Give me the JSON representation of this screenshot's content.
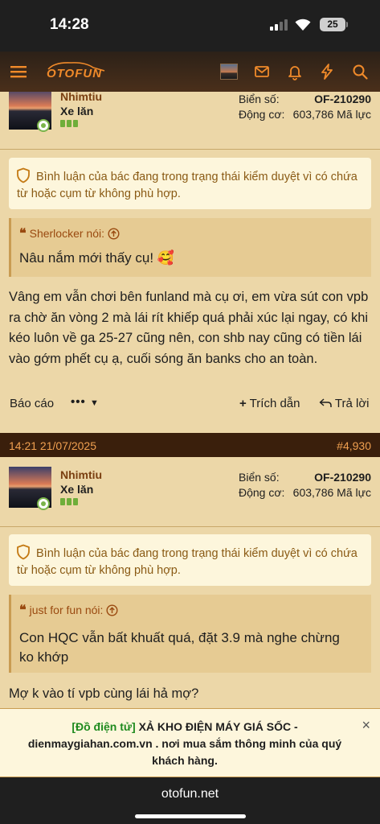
{
  "status_bar": {
    "time": "14:28",
    "battery": "25"
  },
  "nav": {
    "logo": "OTOFUN",
    "icons": [
      "menu-icon",
      "envelope-icon",
      "bell-icon",
      "lightning-icon",
      "search-icon"
    ]
  },
  "posts": [
    {
      "username": "Nhimtiu",
      "user_title": "Xe lăn",
      "plate_label": "Biển số:",
      "plate_value": "OF-210290",
      "engine_label": "Động cơ:",
      "engine_value": "603,786 Mã lực",
      "notice": "Bình luận của bác đang trong trạng thái kiểm duyệt vì có chứa từ hoặc cụm từ không phù hợp.",
      "quote_author": "Sherlocker nói:",
      "quote_text": "Nâu nắm mới thấy cụ! 🥰",
      "body": "Vâng em vẫn chơi bên funland mà cụ ơi, em vừa sút con vpb ra chờ ăn vòng 2 mà lái rít khiếp quá phải xúc lại ngay, có khi kéo luôn về ga 25-27 cũng nên, con shb nay cũng có tiền lái vào gớm phết cụ ạ, cuối sóng ăn banks cho an toàn.",
      "actions": {
        "report": "Báo cáo",
        "more": "•••",
        "quote": "Trích dẫn",
        "reply": "Trả lời"
      }
    },
    {
      "date": "14:21 21/07/2025",
      "number": "#4,930",
      "username": "Nhimtiu",
      "user_title": "Xe lăn",
      "plate_label": "Biển số:",
      "plate_value": "OF-210290",
      "engine_label": "Động cơ:",
      "engine_value": "603,786 Mã lực",
      "notice": "Bình luận của bác đang trong trạng thái kiểm duyệt vì có chứa từ hoặc cụm từ không phù hợp.",
      "quote_author": "just for fun nói:",
      "quote_text": "Con HQC vẫn bất khuất quá, đặt 3.9 mà nghe chừng ko khớp",
      "body": "Mợ k vào tí vpb cùng lái hả mợ?"
    }
  ],
  "ad": {
    "tag": "[Đồ điện tử]",
    "text": "XẢ KHO ĐIỆN MÁY GIÁ SỐC - dienmaygiahan.com.vn . nơi mua sắm thông minh của quý khách hàng.",
    "close": "×"
  },
  "browser": {
    "url": "otofun.net"
  },
  "colors": {
    "page_bg": "#ecd7a8",
    "accent": "#f08a2a",
    "username": "#7a3f10",
    "notice_text": "#8a5a14",
    "post_bar": "#3a1f0c"
  }
}
